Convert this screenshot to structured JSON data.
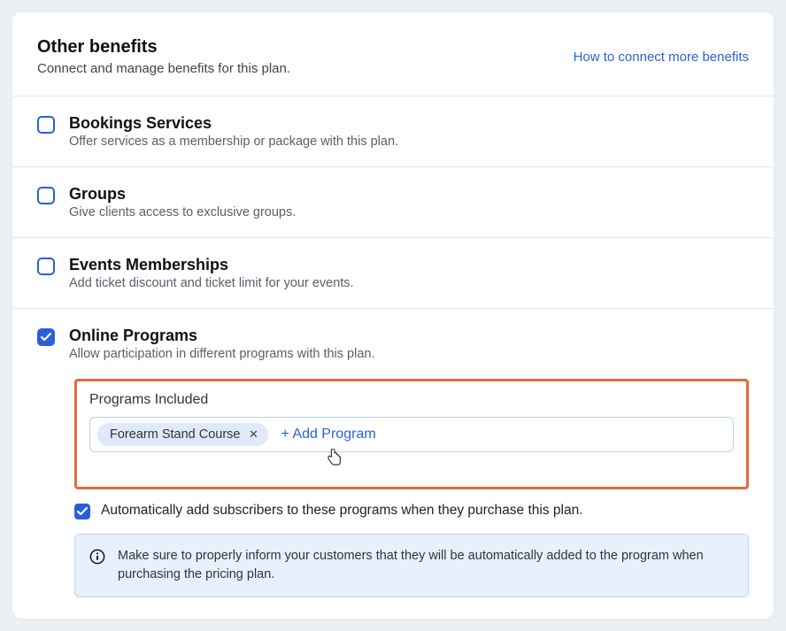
{
  "header": {
    "title": "Other benefits",
    "subtitle": "Connect and manage benefits for this plan.",
    "link": "How to connect more benefits"
  },
  "benefits": [
    {
      "title": "Bookings Services",
      "desc": "Offer services as a membership or package with this plan."
    },
    {
      "title": "Groups",
      "desc": "Give clients access to exclusive groups."
    },
    {
      "title": "Events Memberships",
      "desc": "Add ticket discount and ticket limit for your events."
    },
    {
      "title": "Online Programs",
      "desc": "Allow participation in different programs with this plan."
    }
  ],
  "programs": {
    "label": "Programs Included",
    "chip": "Forearm Stand Course",
    "add": "+ Add Program"
  },
  "autoAdd": {
    "label": "Automatically add subscribers to these programs when they purchase this plan."
  },
  "info": {
    "text": "Make sure to properly inform your customers that they will be automatically added to the program when purchasing the pricing plan."
  }
}
